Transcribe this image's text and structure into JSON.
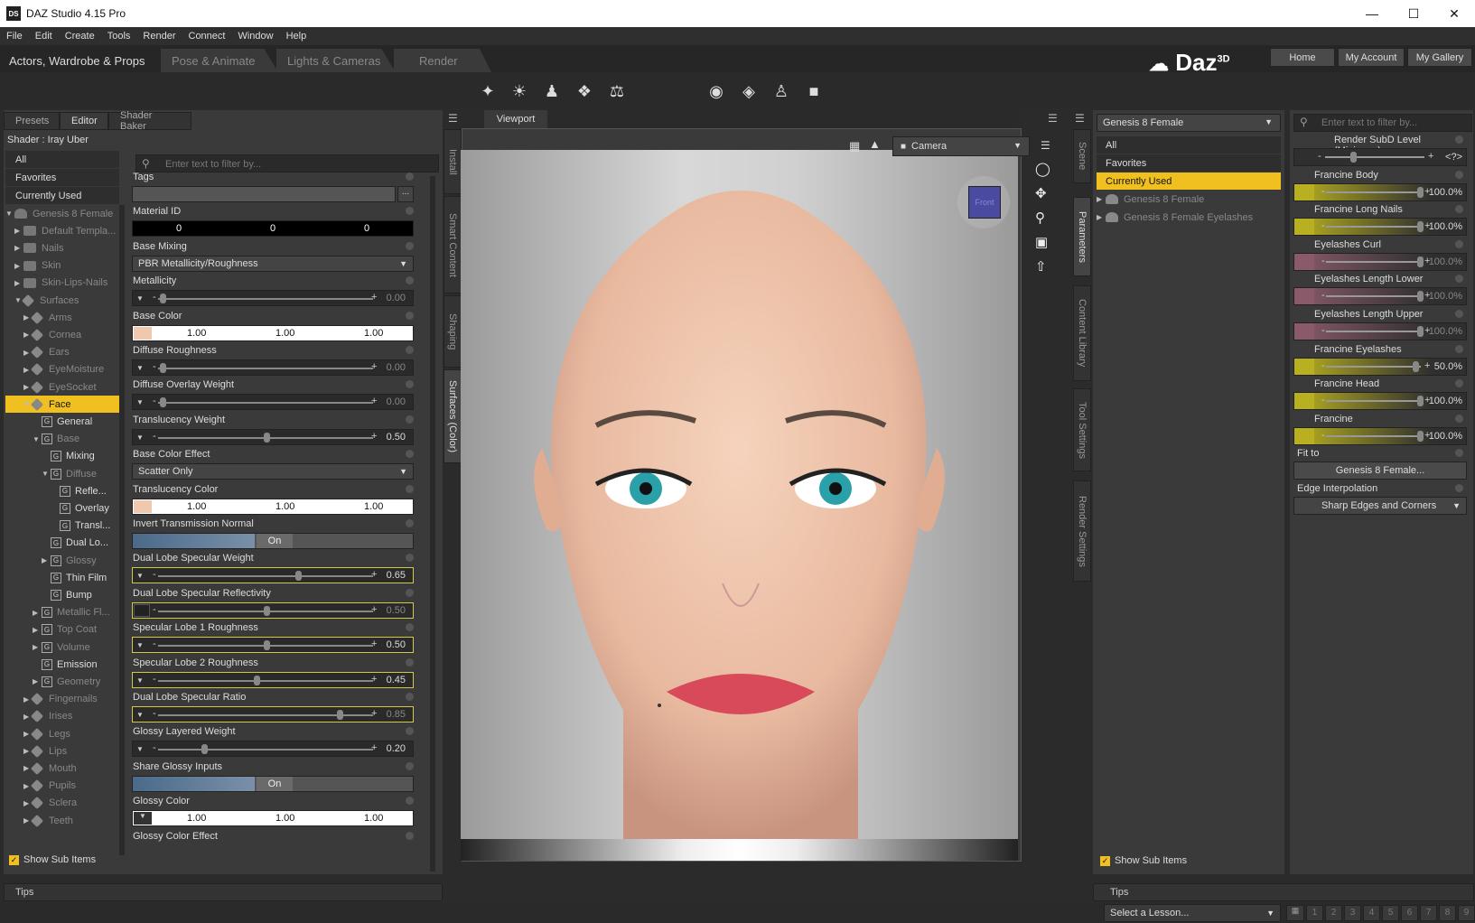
{
  "window": {
    "title": "DAZ Studio 4.15 Pro",
    "icon": "DS"
  },
  "menu": [
    "File",
    "Edit",
    "Create",
    "Tools",
    "Render",
    "Connect",
    "Window",
    "Help"
  ],
  "rooms": [
    "Actors, Wardrobe & Props",
    "Pose & Animate",
    "Lights & Cameras",
    "Render"
  ],
  "brand": {
    "name": "Daz",
    "sup": "3D"
  },
  "header_buttons": [
    "Home",
    "My Account",
    "My Gallery"
  ],
  "left_tabs": [
    "Presets",
    "Editor",
    "Shader Baker"
  ],
  "shader_label": "Shader : Iray Uber",
  "categories": [
    "All",
    "Favorites",
    "Currently Used"
  ],
  "tree": [
    {
      "label": "Genesis 8 Female",
      "indent": 0,
      "icon": "figure"
    },
    {
      "label": "Default Templa...",
      "indent": 1,
      "icon": "folder"
    },
    {
      "label": "Nails",
      "indent": 1,
      "icon": "folder"
    },
    {
      "label": "Skin",
      "indent": 1,
      "icon": "folder"
    },
    {
      "label": "Skin-Lips-Nails",
      "indent": 1,
      "icon": "folder"
    },
    {
      "label": "Surfaces",
      "indent": 1,
      "icon": "surface"
    },
    {
      "label": "Arms",
      "indent": 2,
      "icon": "surface"
    },
    {
      "label": "Cornea",
      "indent": 2,
      "icon": "surface"
    },
    {
      "label": "Ears",
      "indent": 2,
      "icon": "surface"
    },
    {
      "label": "EyeMoisture",
      "indent": 2,
      "icon": "surface"
    },
    {
      "label": "EyeSocket",
      "indent": 2,
      "icon": "surface"
    },
    {
      "label": "Face",
      "indent": 2,
      "icon": "surface",
      "selected": true
    },
    {
      "label": "General",
      "indent": 3,
      "icon": "G",
      "bright": true
    },
    {
      "label": "Base",
      "indent": 3,
      "icon": "G"
    },
    {
      "label": "Mixing",
      "indent": 4,
      "icon": "G",
      "bright": true
    },
    {
      "label": "Diffuse",
      "indent": 4,
      "icon": "G"
    },
    {
      "label": "Refle...",
      "indent": 5,
      "icon": "G",
      "bright": true
    },
    {
      "label": "Overlay",
      "indent": 5,
      "icon": "G",
      "bright": true
    },
    {
      "label": "Transl...",
      "indent": 5,
      "icon": "G",
      "bright": true
    },
    {
      "label": "Dual Lo...",
      "indent": 4,
      "icon": "G",
      "bright": true
    },
    {
      "label": "Glossy",
      "indent": 4,
      "icon": "G"
    },
    {
      "label": "Thin Film",
      "indent": 4,
      "icon": "G",
      "bright": true
    },
    {
      "label": "Bump",
      "indent": 4,
      "icon": "G",
      "bright": true
    },
    {
      "label": "Metallic Fl...",
      "indent": 3,
      "icon": "G"
    },
    {
      "label": "Top Coat",
      "indent": 3,
      "icon": "G"
    },
    {
      "label": "Volume",
      "indent": 3,
      "icon": "G"
    },
    {
      "label": "Emission",
      "indent": 3,
      "icon": "G",
      "bright": true
    },
    {
      "label": "Geometry",
      "indent": 3,
      "icon": "G"
    },
    {
      "label": "Fingernails",
      "indent": 2,
      "icon": "surface"
    },
    {
      "label": "Irises",
      "indent": 2,
      "icon": "surface"
    },
    {
      "label": "Legs",
      "indent": 2,
      "icon": "surface"
    },
    {
      "label": "Lips",
      "indent": 2,
      "icon": "surface"
    },
    {
      "label": "Mouth",
      "indent": 2,
      "icon": "surface"
    },
    {
      "label": "Pupils",
      "indent": 2,
      "icon": "surface"
    },
    {
      "label": "Sclera",
      "indent": 2,
      "icon": "surface"
    },
    {
      "label": "Teeth",
      "indent": 2,
      "icon": "surface"
    }
  ],
  "show_sub_items": "Show Sub Items",
  "filter_placeholder": "Enter text to filter by...",
  "props": [
    {
      "label": "Tags",
      "kind": "tags"
    },
    {
      "label": "Material ID",
      "kind": "triple_black",
      "vals": [
        "0",
        "0",
        "0"
      ]
    },
    {
      "label": "Base Mixing",
      "kind": "select",
      "value": "PBR Metallicity/Roughness"
    },
    {
      "label": "Metallicity",
      "kind": "slider",
      "value": "0.00",
      "pos": 0.0
    },
    {
      "label": "Base Color",
      "kind": "rgb",
      "vals": [
        "1.00",
        "1.00",
        "1.00"
      ]
    },
    {
      "label": "Diffuse Roughness",
      "kind": "slider",
      "value": "0.00",
      "pos": 0.0
    },
    {
      "label": "Diffuse Overlay Weight",
      "kind": "slider",
      "value": "0.00",
      "pos": 0.0
    },
    {
      "label": "Translucency Weight",
      "kind": "slider",
      "value": "0.50",
      "pos": 0.5,
      "bright": true
    },
    {
      "label": "Base Color Effect",
      "kind": "select",
      "value": "Scatter Only"
    },
    {
      "label": "Translucency Color",
      "kind": "rgb",
      "vals": [
        "1.00",
        "1.00",
        "1.00"
      ]
    },
    {
      "label": "Invert Transmission Normal",
      "kind": "toggle",
      "value": "On"
    },
    {
      "label": "Dual Lobe Specular Weight",
      "kind": "slider",
      "value": "0.65",
      "pos": 0.65,
      "hl": true
    },
    {
      "label": "Dual Lobe Specular Reflectivity",
      "kind": "slider",
      "value": "0.50",
      "pos": 0.5,
      "hl": true,
      "dim": true,
      "swatch": true
    },
    {
      "label": "Specular Lobe 1 Roughness",
      "kind": "slider",
      "value": "0.50",
      "pos": 0.5,
      "hl": true
    },
    {
      "label": "Specular Lobe 2 Roughness",
      "kind": "slider",
      "value": "0.45",
      "pos": 0.45,
      "hl": true
    },
    {
      "label": "Dual Lobe Specular Ratio",
      "kind": "slider",
      "value": "0.85",
      "pos": 0.85,
      "hl": true,
      "dim": true
    },
    {
      "label": "Glossy Layered Weight",
      "kind": "slider",
      "value": "0.20",
      "pos": 0.2,
      "bright": true
    },
    {
      "label": "Share Glossy Inputs",
      "kind": "toggle",
      "value": "On"
    },
    {
      "label": "Glossy Color",
      "kind": "rgb_plain",
      "vals": [
        "1.00",
        "1.00",
        "1.00"
      ]
    },
    {
      "label": "Glossy Color Effect",
      "kind": "partial"
    }
  ],
  "left_vtabs": [
    "Install",
    "Smart Content",
    "Shaping",
    "Surfaces (Color)"
  ],
  "viewport": {
    "tab": "Viewport",
    "camera": "Camera",
    "cube_label": "Front"
  },
  "right_vtabs": [
    "Scene",
    "Parameters",
    "Content Library",
    "Tool Settings",
    "Render Settings"
  ],
  "param_node": "Genesis 8 Female",
  "param_cats": [
    "All",
    "Favorites",
    "Currently Used"
  ],
  "param_tree": [
    "Genesis 8 Female",
    "Genesis 8 Female Eyelashes"
  ],
  "params": [
    {
      "label": "Render SubD Level (Minimum)",
      "kind": "subd",
      "value": "<?>"
    },
    {
      "label": "Francine Body",
      "value": "100.0%",
      "pos": 1.0,
      "color": "#b8b020"
    },
    {
      "label": "Francine Long Nails",
      "value": "100.0%",
      "pos": 1.0,
      "color": "#b8b020"
    },
    {
      "label": "Eyelashes Curl",
      "value": "100.0%",
      "pos": 1.0,
      "color": "#8a5a6a",
      "dim": true
    },
    {
      "label": "Eyelashes Length Lower",
      "value": "100.0%",
      "pos": 1.0,
      "color": "#8a5a6a",
      "dim": true
    },
    {
      "label": "Eyelashes Length Upper",
      "value": "100.0%",
      "pos": 1.0,
      "color": "#8a5a6a",
      "dim": true
    },
    {
      "label": "Francine Eyelashes",
      "value": "50.0%",
      "pos": 0.95,
      "color": "#b8b020"
    },
    {
      "label": "Francine Head",
      "value": "100.0%",
      "pos": 1.0,
      "color": "#b8b020"
    },
    {
      "label": "Francine",
      "value": "100.0%",
      "pos": 1.0,
      "color": "#b8b020"
    },
    {
      "label": "Fit to",
      "kind": "button",
      "value": "Genesis 8 Female..."
    },
    {
      "label": "Edge Interpolation",
      "kind": "select",
      "value": "Sharp Edges and Corners"
    }
  ],
  "tips": "Tips",
  "lesson": "Select a Lesson...",
  "lesson_pages": [
    "1",
    "2",
    "3",
    "4",
    "5",
    "6",
    "7",
    "8",
    "9"
  ]
}
